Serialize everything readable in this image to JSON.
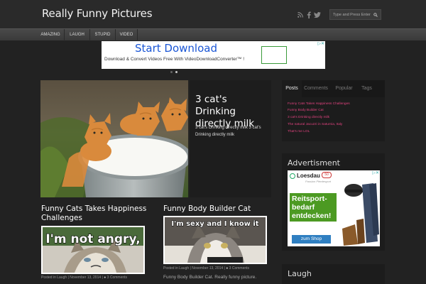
{
  "header": {
    "site_title": "Really Funny Pictures",
    "search_placeholder": "Type and Press Enter",
    "social": [
      "rss-icon",
      "facebook-icon",
      "twitter-icon"
    ]
  },
  "nav": {
    "items": [
      "AMAZING",
      "LAUGH",
      "STUPID",
      "VIDEO"
    ]
  },
  "ad_banner": {
    "title": "Start Download",
    "subtitle": "Download & Convert Videos Free With VideoDownloadConverter™ !"
  },
  "featured": {
    "title": "3 cat's Drinking directly milk",
    "excerpt": "3 cat's Drinking directly milk 3 cat's Drinking directly milk"
  },
  "posts": [
    {
      "title": "Funny Cats Takes Happiness Challenges",
      "image_caption": "I'm not angry,",
      "meta_category": "Posted in Laugh",
      "meta_date": "November 13, 2014",
      "meta_comments": "3 Comments",
      "excerpt": ""
    },
    {
      "title": "Funny Body Builder Cat",
      "image_caption": "I'm sexy and I know it",
      "meta_category": "Posted in Laugh",
      "meta_date": "November 13, 2014",
      "meta_comments": "3 Comments",
      "excerpt": "Funny Body Builder Cat. Really funny picture."
    }
  ],
  "sidebar": {
    "tabs": [
      "Posts",
      "Comments",
      "Popular",
      "Tags"
    ],
    "active_tab": "Posts",
    "tab_posts": [
      "Funny Cats Takes Happiness Challenges",
      "Funny Body Builder Cat",
      "3 cat's Drinking directly milk",
      "The natural Jacuzzi in Saturnia, Italy",
      "That's me LOL"
    ],
    "advertisment_title": "Advertisment",
    "laugh_title": "Laugh",
    "ad": {
      "brand": "Loesdau",
      "badge": "50",
      "tagline": "Passion Pferdesport",
      "headline": "Reitsport-bedarf entdecken!",
      "button": "zum Shop"
    }
  },
  "colors": {
    "background": "#222222",
    "header": "#2a2a2a",
    "accent_link": "#e0427e",
    "ad_blue": "#1a56d6"
  }
}
